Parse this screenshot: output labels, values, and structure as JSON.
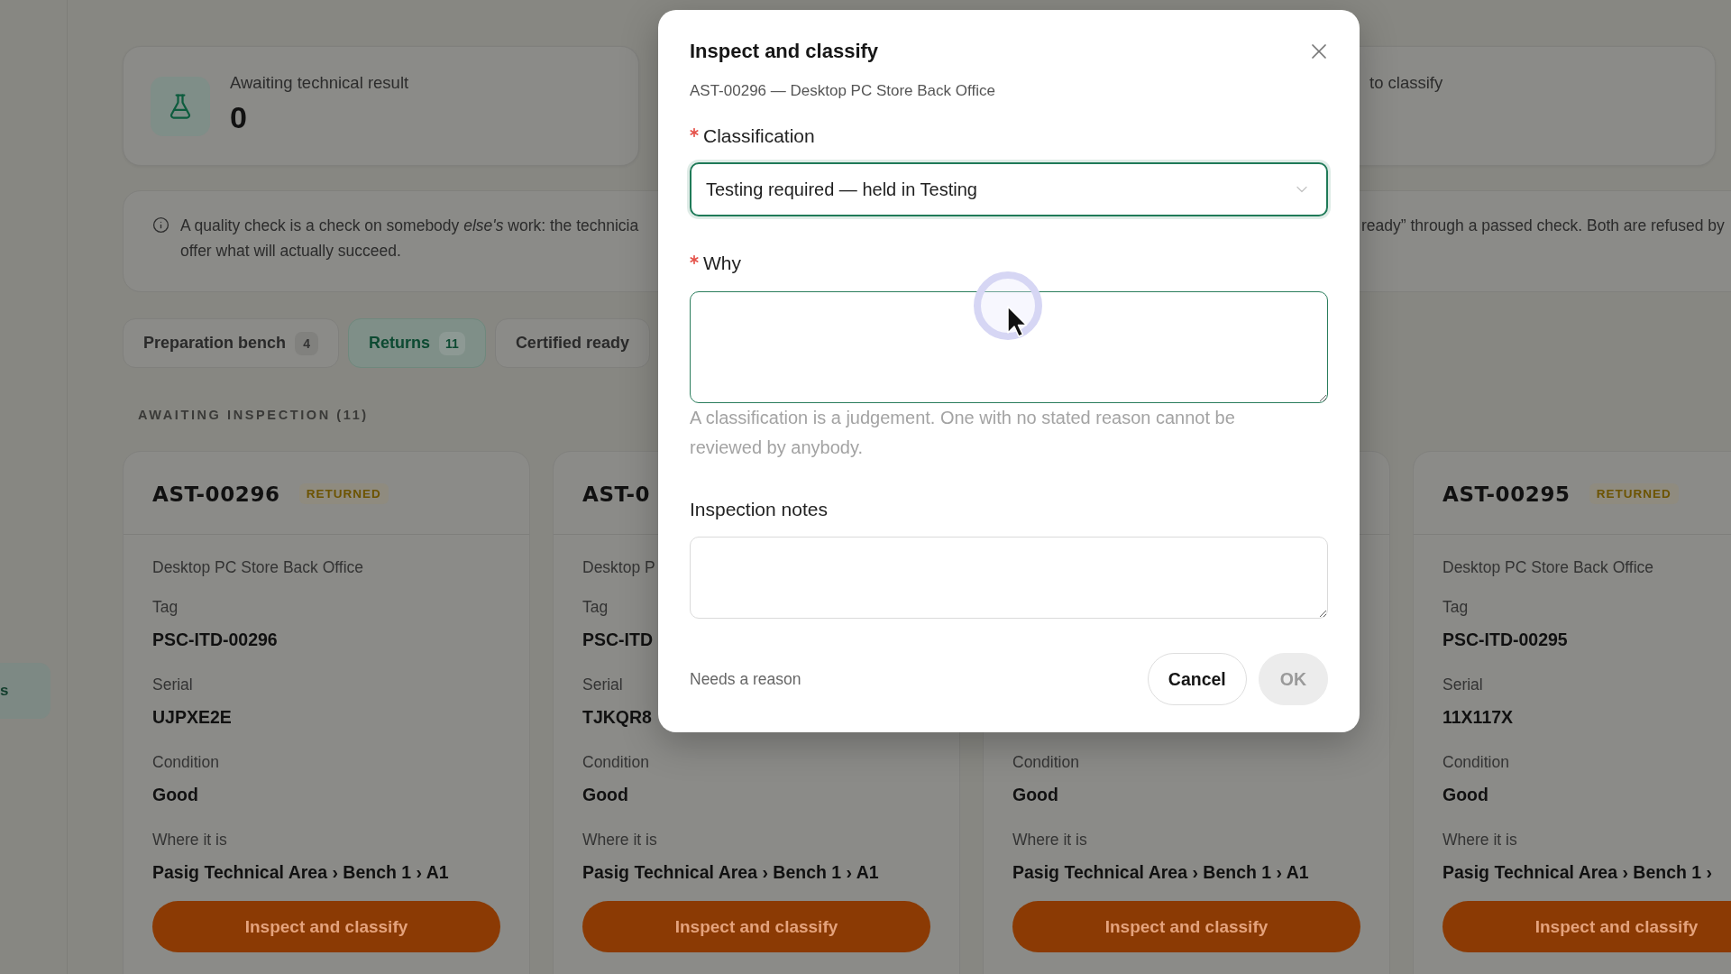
{
  "sidebar": {
    "items": [
      {
        "label": "s",
        "selected": true
      }
    ]
  },
  "stat_cards": [
    {
      "kind": "tile",
      "label": "Awaiting technical result",
      "value": "0"
    },
    {
      "kind": "plain",
      "label": "to classify"
    }
  ],
  "notice": {
    "lines": [
      "A quality check is a check on somebody *else's* work: the technicia",
      "offer what will actually succeed."
    ],
    "continuation": "ready” through a passed check. Both are refused by"
  },
  "tabs": [
    {
      "label": "Preparation bench",
      "count": "4",
      "selected": false
    },
    {
      "label": "Returns",
      "count": "11",
      "selected": true
    },
    {
      "label": "Certified ready",
      "selected": false
    }
  ],
  "section_heading": "AWAITING INSPECTION (11)",
  "asset_cards": [
    {
      "id": "AST-00296",
      "status": "RETURNED",
      "description": "Desktop PC Store Back Office",
      "fields": [
        {
          "label": "Tag",
          "value": "PSC-ITD-00296"
        },
        {
          "label": "Serial",
          "value": "UJPXE2E"
        },
        {
          "label": "Condition",
          "value": "Good"
        },
        {
          "label": "Where it is",
          "value": "Pasig Technical Area › Bench 1 › A1"
        }
      ],
      "button": "Inspect and classify"
    },
    {
      "id": "AST-0",
      "description": "Desktop P",
      "fields": [
        {
          "label": "Tag",
          "value": "PSC-ITD"
        },
        {
          "label": "Serial",
          "value": "TJKQR8"
        },
        {
          "label": "Condition",
          "value": "Good"
        },
        {
          "label": "Where it is",
          "value": "Pasig Technical Area › Bench 1 › A1"
        }
      ],
      "button": "Inspect and classify"
    },
    {
      "fields": [
        {
          "label": "Condition",
          "value": "Good"
        },
        {
          "label": "Where it is",
          "value": "Pasig Technical Area › Bench 1 › A1"
        }
      ],
      "button": "Inspect and classify"
    },
    {
      "id": "AST-00295",
      "status": "RETURNED",
      "description": "Desktop PC Store Back Office",
      "fields": [
        {
          "label": "Tag",
          "value": "PSC-ITD-00295"
        },
        {
          "label": "Serial",
          "value": "11X117X"
        },
        {
          "label": "Condition",
          "value": "Good"
        },
        {
          "label": "Where it is",
          "value": "Pasig Technical Area › Bench 1 ›"
        }
      ],
      "button": "Inspect and classify"
    }
  ],
  "dialog": {
    "title": "Inspect and classify",
    "subtitle": "AST-00296 — Desktop PC Store Back Office",
    "fields": [
      {
        "kind": "select",
        "label": "Classification",
        "required": true,
        "focused": true,
        "hovered": false,
        "value": "Testing required — held in Testing"
      },
      {
        "kind": "textarea",
        "label": "Why",
        "required": true,
        "focused": false,
        "hovered": true,
        "help": "A classification is a judgement. One with no stated reason cannot be reviewed by anybody."
      },
      {
        "kind": "textarea",
        "label": "Inspection notes",
        "required": false,
        "focused": false,
        "hovered": false
      }
    ],
    "hint": "Needs a reason",
    "buttons": [
      {
        "kind": "cancel",
        "label": "Cancel",
        "disabled": false
      },
      {
        "kind": "confirm",
        "label": "OK",
        "disabled": true
      }
    ]
  }
}
